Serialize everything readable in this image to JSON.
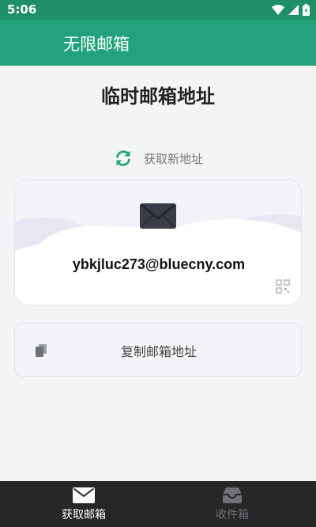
{
  "status_bar": {
    "time": "5:06"
  },
  "app_bar": {
    "title": "无限邮箱"
  },
  "main": {
    "title": "临时邮箱地址",
    "refresh_label": "获取新地址",
    "email_address": "ybkjluc273@bluecny.com",
    "copy_label": "复制邮箱地址"
  },
  "bottom_nav": {
    "items": [
      {
        "label": "获取邮箱",
        "icon": "mail-icon",
        "active": true
      },
      {
        "label": "收件箱",
        "icon": "inbox-icon",
        "active": false
      }
    ]
  },
  "colors": {
    "status_bar": "#1e8f6a",
    "app_bar": "#22a37b",
    "accent": "#22a37b",
    "bottom_nav": "#27272a"
  }
}
